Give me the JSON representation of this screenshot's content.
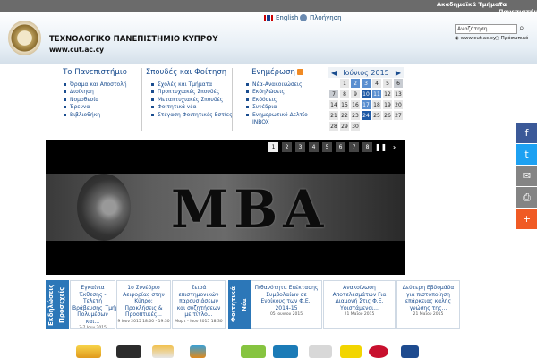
{
  "topbar": {
    "departments": "Ακαδημαϊκά Τμήματα",
    "about": "Το Πανεπιστήμιο"
  },
  "header": {
    "title": "ΤΕΧΝΟΛΟΓΙΚΟ ΠΑΝΕΠΙΣΤΗΜΙΟ ΚΥΠΡΟΥ",
    "url": "www.cut.ac.cy",
    "english": "English",
    "navigation": "Πλοήγηση",
    "search_placeholder": "Αναζήτηση...",
    "radio_site": "www.cut.ac.cy",
    "radio_people": "Πρόσωπικό"
  },
  "menus": [
    {
      "title": "Το Πανεπιστήμιο",
      "items": [
        "Όραμα και Αποστολή",
        "Διοίκηση",
        "Νομοθεσία",
        "Έρευνα",
        "Βιβλιοθήκη"
      ]
    },
    {
      "title": "Σπουδές και Φοίτηση",
      "items": [
        "Σχολές και Τμήματα",
        "Προπτυχιακές Σπουδές",
        "Μεταπτυχιακές Σπουδές",
        "Φοιτητικά νέα",
        "Στέγαση-Φοιτητικές Εστίες"
      ]
    },
    {
      "title": "Ενημέρωση",
      "items": [
        "Νέα-Ανακοινώσεις",
        "Εκδηλώσεις",
        "Εκδόσεις",
        "Συνέδρια",
        "Ενημερωτικό Δελτίο INBOX"
      ]
    }
  ],
  "calendar": {
    "month": "Ιούνιος 2015",
    "prev": "◀",
    "next": "▶",
    "days": [
      "",
      "1",
      "2",
      "3",
      "4",
      "5",
      "6",
      "7",
      "8",
      "9",
      "10",
      "11",
      "12",
      "13",
      "14",
      "15",
      "16",
      "17",
      "18",
      "19",
      "20",
      "21",
      "22",
      "23",
      "24",
      "25",
      "26",
      "27",
      "28",
      "29",
      "30",
      "",
      "",
      "",
      "",
      ""
    ]
  },
  "slider": {
    "pages": [
      "1",
      "2",
      "3",
      "4",
      "5",
      "6",
      "7",
      "8"
    ],
    "pause": "❚❚",
    "next": "›",
    "banner_text": "MBA"
  },
  "side_labels": {
    "events": "Εκδηλώσεις Προσεχείς",
    "news": "Φοιτητικά Νέα"
  },
  "news": [
    {
      "title": "Εγκαίνια Έκθεσης - Τελετή Βράβευσης_Τμήμα Πολυμέσων και...",
      "date": "3-7 Ιουν 2015"
    },
    {
      "title": "1ο Συνέδριο Αειφορίας στην Κύπρο: Προκλήσεις & Προοπτικές...",
      "date": "9 Ιουν 2015 18:00 - 19:30"
    },
    {
      "title": "Σειρά επιστημονικών παρουσιάσεων και συζητήσεων με τίτλο...",
      "date": "Μαρτ - Ιουν 2015 18:30"
    },
    {
      "title": "Πιθανότητα Επέκτασης Συμβολαίων σε Ενοίκους των Φ.Ε., 2014-15",
      "date": "05 Ιουνίου 2015"
    },
    {
      "title": "Ανακοίνωση Αποτελεσμάτων Για Διαμονή Στις Φ.Ε. Υφιστάμενοι...",
      "date": "21 Μαΐου 2015"
    },
    {
      "title": "Δεύτερη Εβδομάδα για πιστοποίηση επάρκειας καλής γνώσης της...",
      "date": "21 Μαΐου 2015"
    }
  ],
  "share": [
    {
      "icon": "facebook-icon",
      "glyph": "f",
      "color": "#3b5998"
    },
    {
      "icon": "twitter-icon",
      "glyph": "t",
      "color": "#1da1f2"
    },
    {
      "icon": "email-icon",
      "glyph": "✉",
      "color": "#848484"
    },
    {
      "icon": "print-icon",
      "glyph": "⎙",
      "color": "#848484"
    },
    {
      "icon": "plus-icon",
      "glyph": "+",
      "color": "#f05a24"
    }
  ],
  "colors": {
    "accent": "#1a4d8f",
    "topbar": "#6b6b6b",
    "label_blue": "#2c77b8"
  }
}
